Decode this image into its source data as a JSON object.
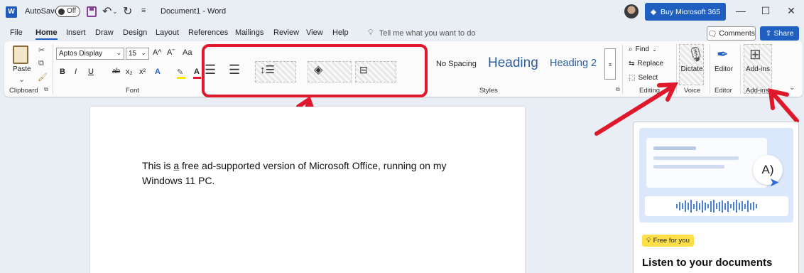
{
  "titlebar": {
    "autosave_label": "AutoSave",
    "autosave_state": "Off",
    "document_title": "Document1  -  Word",
    "buy_label": "Buy Microsoft 365",
    "word_logo_letter": "W"
  },
  "menu": {
    "tabs": [
      "File",
      "Home",
      "Insert",
      "Draw",
      "Design",
      "Layout",
      "References",
      "Mailings",
      "Review",
      "View",
      "Help"
    ],
    "active_tab": "Home",
    "tell_me": "Tell me what you want to do",
    "comments_label": "Comments",
    "share_label": "Share"
  },
  "ribbon": {
    "clipboard": {
      "paste_label": "Paste",
      "group_label": "Clipboard"
    },
    "font": {
      "font_name": "Aptos Display",
      "font_size": "15",
      "group_label": "Font",
      "bold": "B",
      "italic": "I",
      "underline": "U",
      "strike": "ab",
      "subscript": "x₂",
      "superscript": "x²",
      "grow": "A^",
      "shrink": "Aˇ",
      "case": "Aa"
    },
    "styles": {
      "no_spacing": "No Spacing",
      "heading": "Heading",
      "heading2": "Heading 2",
      "group_label": "Styles"
    },
    "editing": {
      "find": "Find",
      "replace": "Replace",
      "select": "Select",
      "group_label": "Editing"
    },
    "voice": {
      "dictate_label": "Dictate",
      "group_label": "Voice"
    },
    "editor": {
      "editor_label": "Editor",
      "group_label": "Editor"
    },
    "addins": {
      "addins_label": "Add-ins",
      "group_label": "Add-ins"
    }
  },
  "document": {
    "text_before": "This is ",
    "text_underlined": "a",
    "text_after": " free ad-supported version of Microsoft Office, running on my Windows 11 PC."
  },
  "side_pane": {
    "badge": "Free for you",
    "title": "Listen to your documents"
  },
  "colors": {
    "accent": "#1f5fbf",
    "annotation_red": "#e0182c"
  }
}
